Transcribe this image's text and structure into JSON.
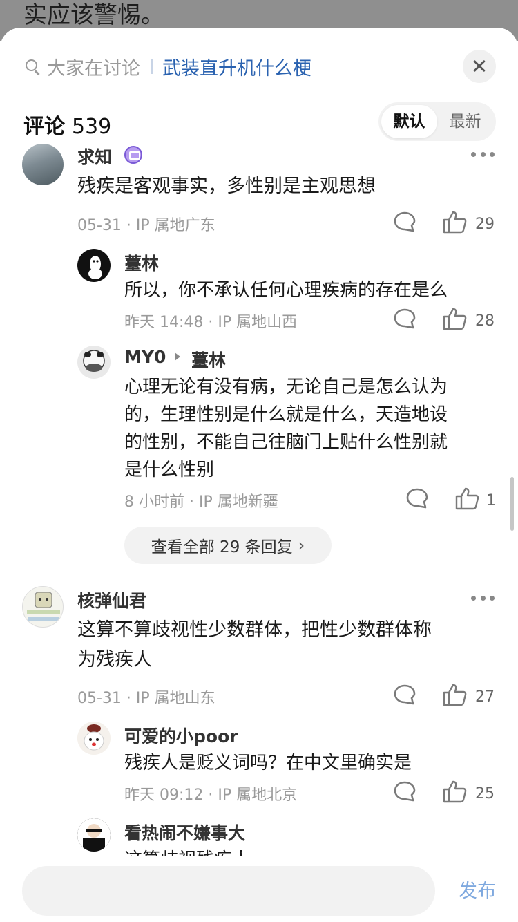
{
  "background": {
    "text": "实应该警惕。"
  },
  "header": {
    "search_prefix": "大家在讨论",
    "search_topic": "武装直升机什么梗"
  },
  "comments_header": {
    "label": "评论",
    "count": "539",
    "sort_options": [
      "默认",
      "最新"
    ],
    "active_sort": "默认"
  },
  "comments": [
    {
      "user": "求知",
      "text": "残疾是客观事实，多性别是主观思想",
      "date": "05-31",
      "location": "IP 属地广东",
      "likes": "29",
      "replies": [
        {
          "user": "薹林",
          "text": "所以，你不承认任何心理疾病的存在是么",
          "date": "昨天 14:48",
          "location": "IP 属地山西",
          "likes": "28"
        },
        {
          "user": "MY0",
          "reply_to": "薹林",
          "text_lines": [
            "心理无论有没有病，无论自己是怎么认为",
            "的，生理性别是什么就是什么，天造地设",
            "的性别，不能自己往脑门上贴什么性别就",
            "是什么性别"
          ],
          "date": "8 小时前",
          "location": "IP 属地新疆",
          "likes": "1"
        }
      ],
      "view_all": "查看全部 29 条回复"
    },
    {
      "user": "核弹仙君",
      "text_lines": [
        "这算不算歧视性少数群体，把性少数群体称",
        "为残疾人"
      ],
      "date": "05-31",
      "location": "IP 属地山东",
      "likes": "27",
      "replies": [
        {
          "user": "可爱的小poor",
          "text": "残疾人是贬义词吗？在中文里确实是",
          "date": "昨天 09:12",
          "location": "IP 属地北京",
          "likes": "25"
        },
        {
          "user": "看热闹不嫌事大",
          "text": "这算歧视残疾人"
        }
      ]
    }
  ],
  "footer": {
    "input_placeholder": "",
    "publish_label": "发布"
  },
  "colors": {
    "accent_link": "#2a62b0",
    "publish": "#7fa9df"
  }
}
